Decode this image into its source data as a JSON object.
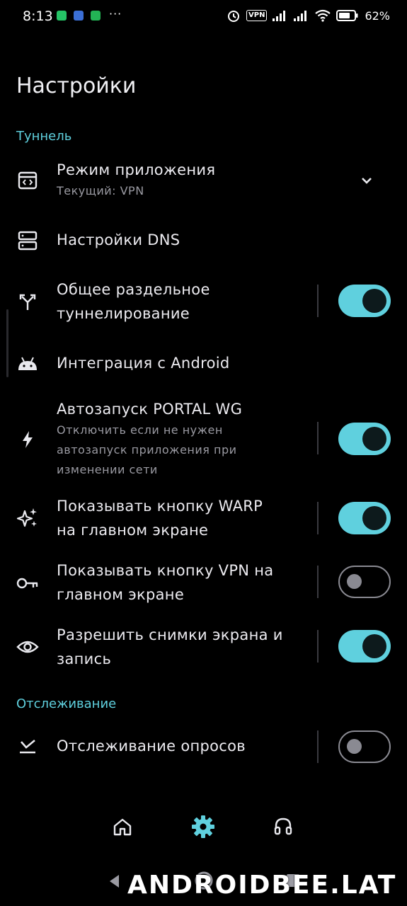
{
  "status_bar": {
    "time": "8:13",
    "vpn_label": "VPN",
    "battery_percent": "62%",
    "dots": "···"
  },
  "page": {
    "title": "Настройки"
  },
  "sections": {
    "tunnel": "Туннель",
    "tracking": "Отслеживание"
  },
  "settings": {
    "app_mode": {
      "title": "Режим приложения",
      "subtitle": "Текущий: VPN"
    },
    "dns": {
      "title": "Настройки DNS"
    },
    "split_tunnel": {
      "title_l1": "Общее раздельное",
      "title_l2": "туннелирование",
      "enabled": true
    },
    "android_integration": {
      "title": "Интеграция с Android"
    },
    "autostart": {
      "title": "Автозапуск PORTAL WG",
      "sub_l1": "Отключить если не нужен",
      "sub_l2": "автозапуск приложения при",
      "sub_l3": "изменении сети",
      "enabled": true
    },
    "warp_button": {
      "title_l1": "Показывать кнопку WARP",
      "title_l2": "на главном экране",
      "enabled": true
    },
    "vpn_button": {
      "title_l1": "Показывать кнопку VPN на",
      "title_l2": "главном экране",
      "enabled": false
    },
    "screenshots": {
      "title_l1": "Разрешить снимки экрана и",
      "title_l2": "запись",
      "enabled": true
    },
    "poll_tracking": {
      "title": "Отслеживание опросов",
      "enabled": false
    }
  },
  "bottom_nav": [
    "home-icon",
    "settings-icon",
    "support-headset-icon"
  ],
  "colors": {
    "accent": "#5fd0de",
    "background": "#000000"
  },
  "watermark": "ANDROIDBEE.LAT"
}
